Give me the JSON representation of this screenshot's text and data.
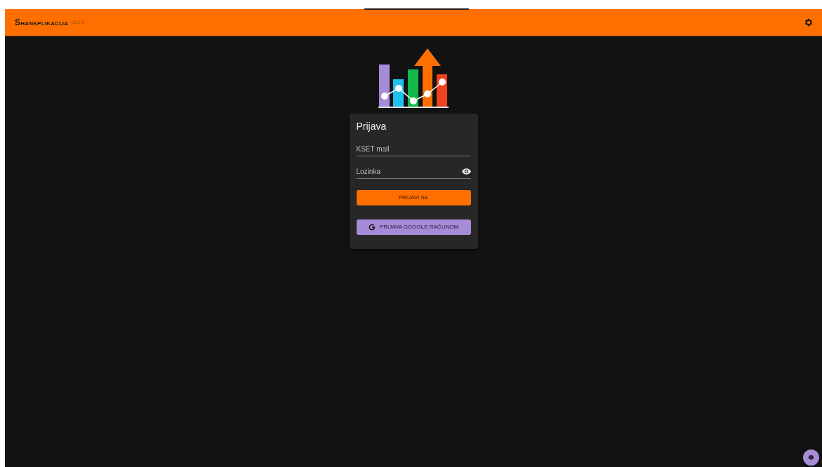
{
  "app_bar": {
    "title": "Shankplikacija",
    "version": "v0.1.0"
  },
  "login": {
    "title": "Prijava",
    "fields": [
      {
        "kind": "text",
        "placeholder": "KSET mail"
      },
      {
        "kind": "password",
        "placeholder": "Lozinka"
      }
    ],
    "submit": "PRIJAVI SE",
    "google": "PRIJAVA GOOGLE RAČUNOM"
  }
}
